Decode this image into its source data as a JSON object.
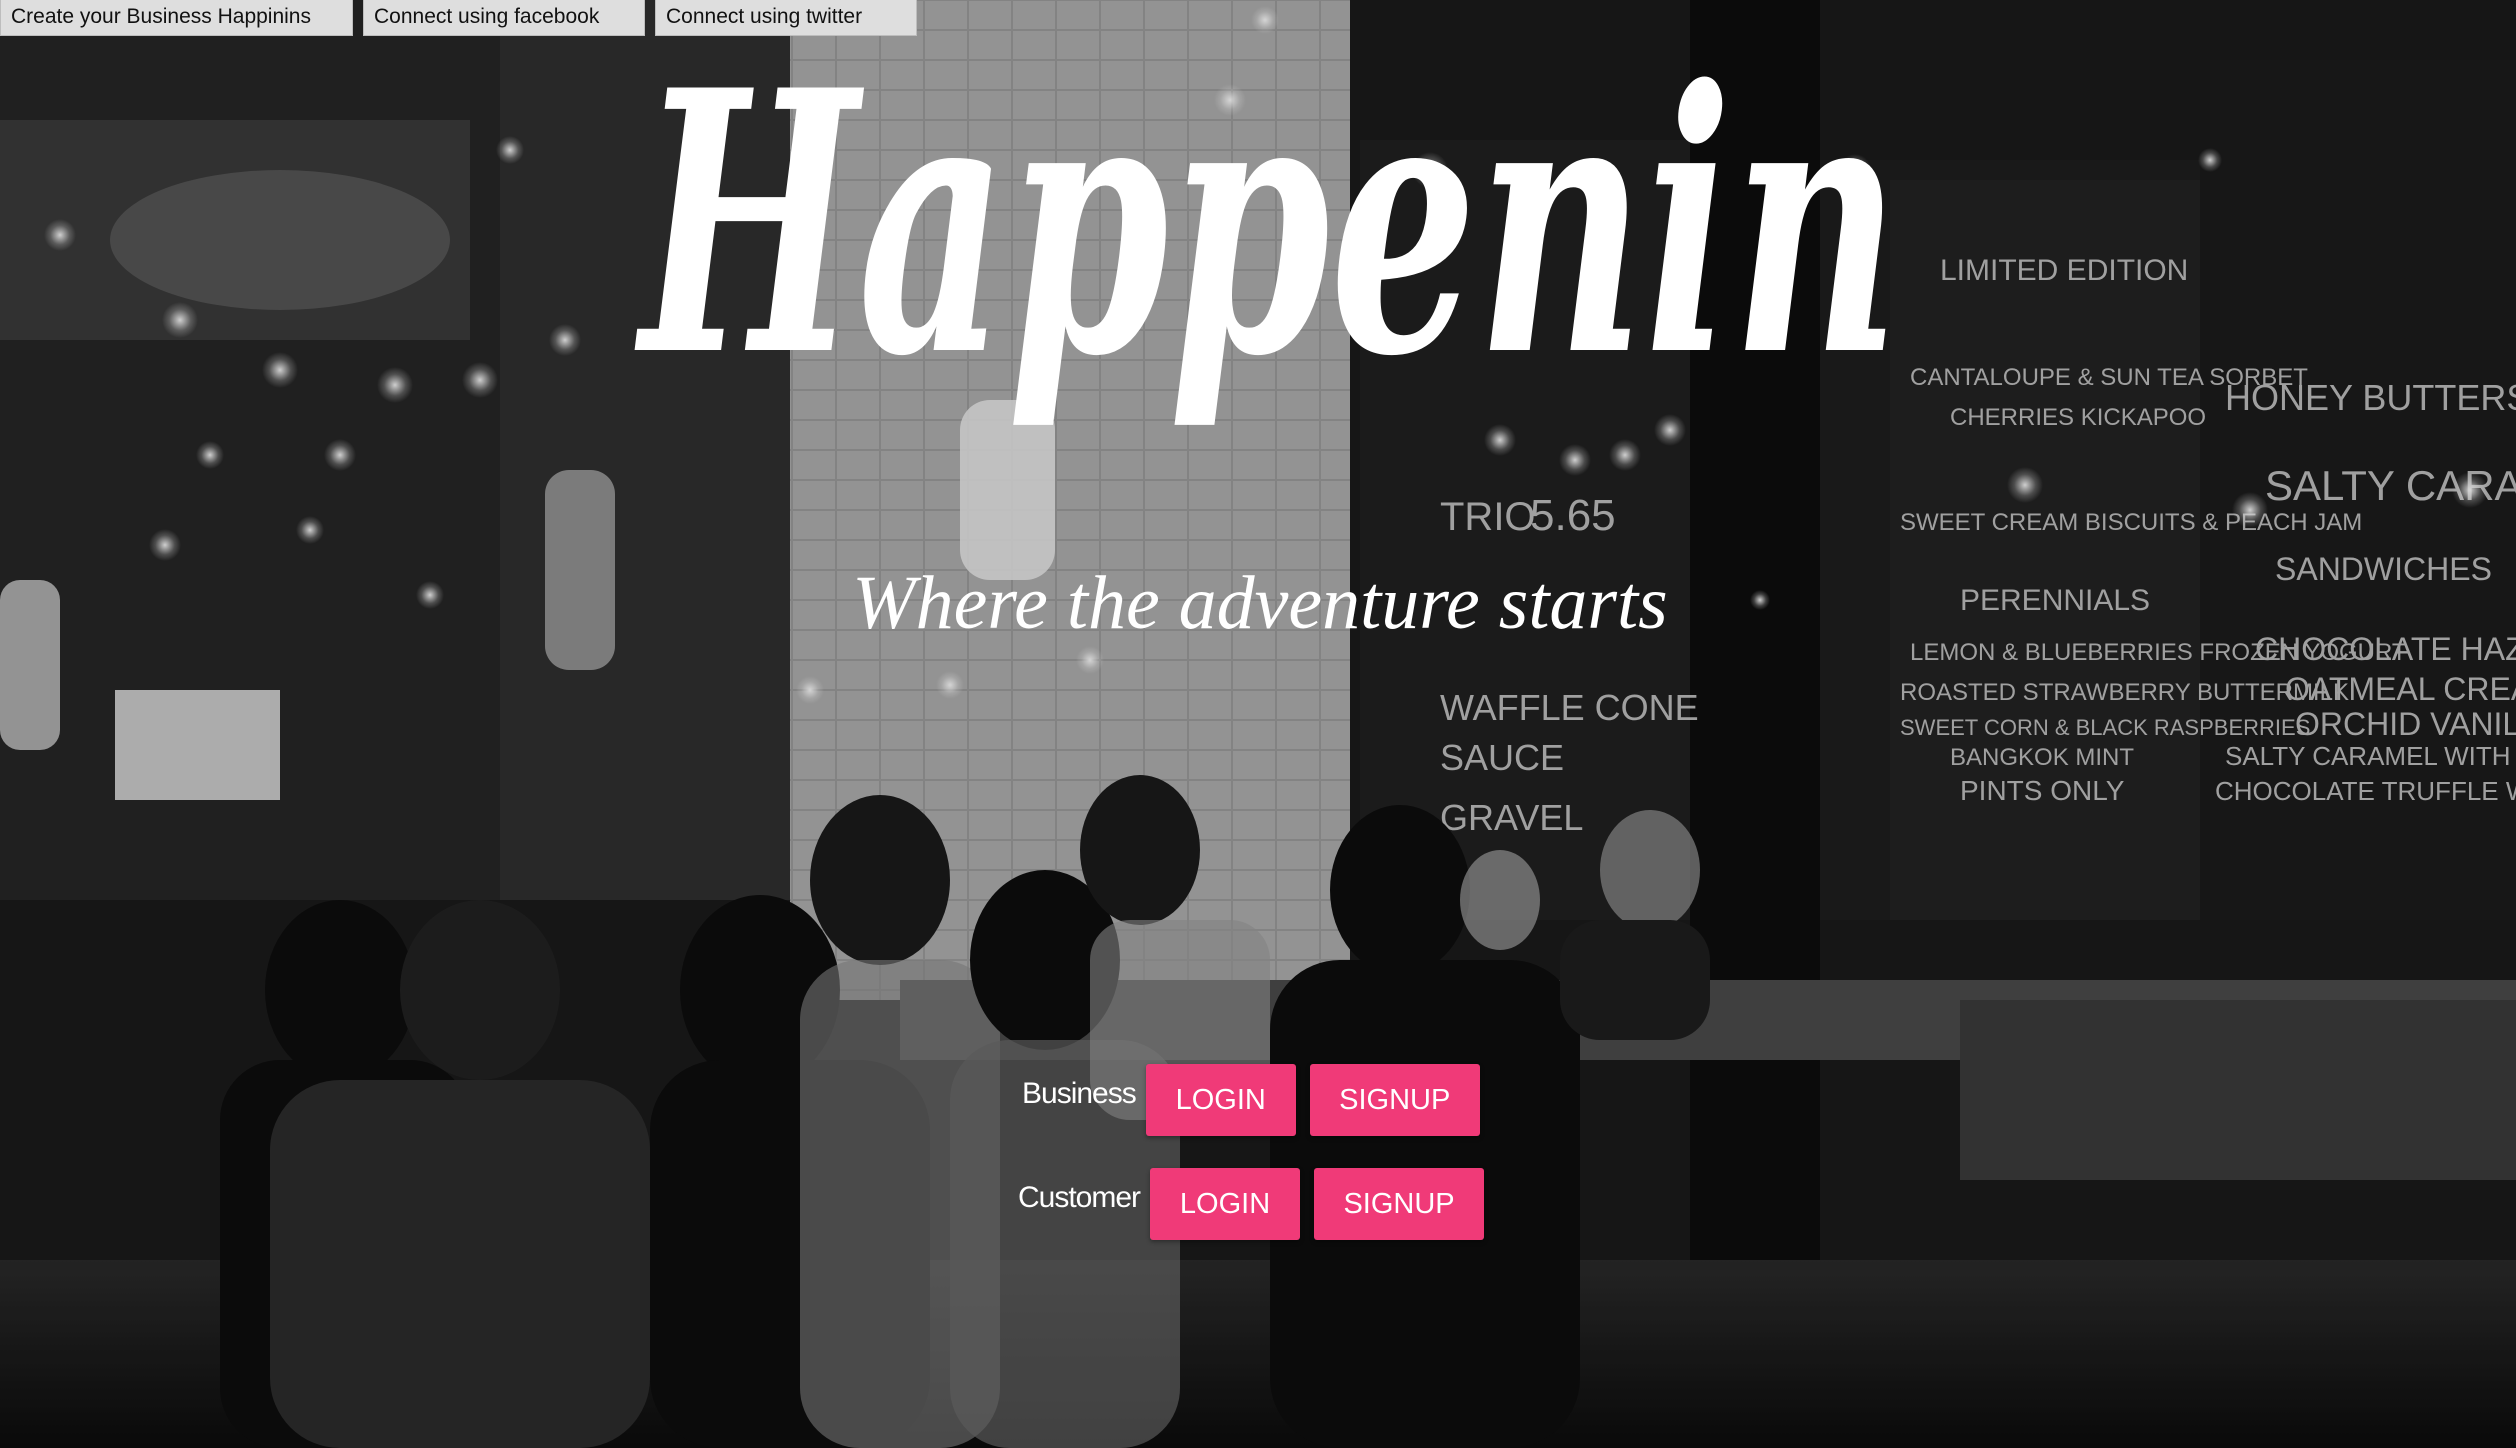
{
  "top_links": {
    "create_business": "Create your Business Happinins",
    "facebook": "Connect using facebook",
    "twitter": "Connect using twitter"
  },
  "brand": {
    "logo_text": "Happenin",
    "tagline": "Where the adventure starts"
  },
  "auth": {
    "business": {
      "label": "Business",
      "login": "LOGIN",
      "signup": "SIGNUP"
    },
    "customer": {
      "label": "Customer",
      "login": "LOGIN",
      "signup": "SIGNUP"
    }
  },
  "colors": {
    "accent": "#f03a78",
    "top_button_bg": "#dedede",
    "text_on_photo": "#ffffff"
  },
  "background": {
    "chalkboard_text": [
      "LIMITED EDITION",
      "CANTALOUPE & SUN TEA SORBET",
      "CHERRIES KICKAPOO",
      "SWEET CREAM BISCUITS & PEACH JAM",
      "PERENNIALS",
      "LEMON & BLUEBERRIES FROZEN YOGURT",
      "ROASTED STRAWBERRY BUTTERMILK",
      "SWEET CORN & BLACK RASPBERRIES",
      "BANGKOK MINT",
      "PINTS ONLY",
      "HONEY BUTTERSCOTCH",
      "SALTY CARAMEL",
      "SANDWICHES",
      "CHOCOLATE HAZELNUT",
      "OATMEAL CREAM",
      "ORCHID VANILLA",
      "SALTY CARAMEL WITH SMOKED ALM",
      "CHOCOLATE TRUFFLE WITH BACKYARD",
      "TRIO",
      "5.65",
      "WAFFLE CONE",
      "SAUCE",
      "GRAVEL"
    ]
  }
}
